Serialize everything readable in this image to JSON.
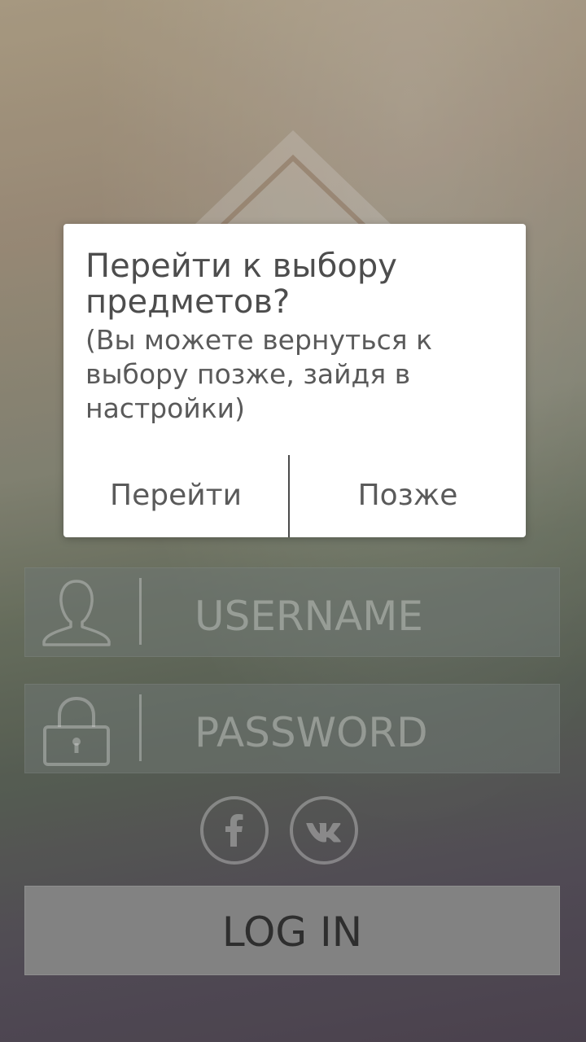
{
  "login": {
    "username_placeholder": "USERNAME",
    "password_placeholder": "PASSWORD",
    "login_button": "LOG IN"
  },
  "social": {
    "facebook_icon": "facebook-icon",
    "vk_icon": "vk-icon"
  },
  "dialog": {
    "title": "Перейти к выбору предметов?",
    "subtitle": "(Вы можете вернуться к выбору позже, зайдя в настройки)",
    "confirm_label": "Перейти",
    "later_label": "Позже"
  },
  "colors": {
    "dialog_background": "#ffffff",
    "login_button": "#8f8f8f",
    "dialog_text": "#4d4d4d"
  }
}
